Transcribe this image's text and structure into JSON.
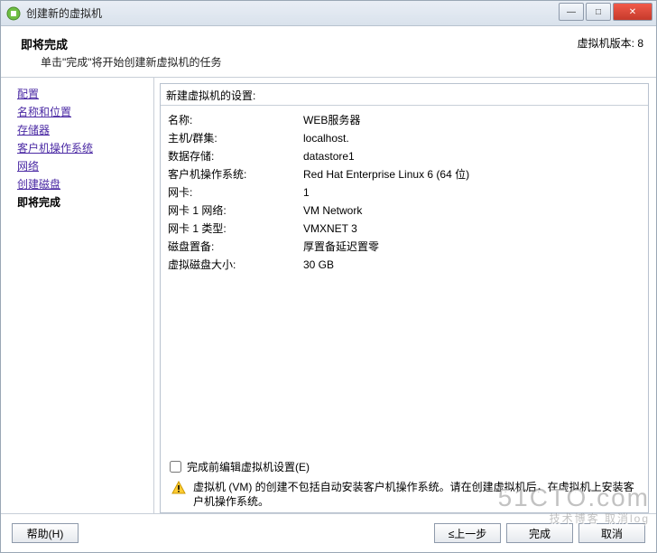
{
  "titlebar": {
    "title": "创建新的虚拟机"
  },
  "header": {
    "title": "即将完成",
    "subtitle": "单击\"完成\"将开始创建新虚拟机的任务",
    "version_label": "虚拟机版本: 8"
  },
  "nav": {
    "items": [
      "配置",
      "名称和位置",
      "存储器",
      "客户机操作系统",
      "网络",
      "创建磁盘"
    ],
    "current": "即将完成"
  },
  "settings_heading": "新建虚拟机的设置:",
  "settings": [
    {
      "k": "名称:",
      "v": "WEB服务器"
    },
    {
      "k": "主机/群集:",
      "v": "localhost."
    },
    {
      "k": "数据存储:",
      "v": "datastore1"
    },
    {
      "k": "客户机操作系统:",
      "v": "Red Hat Enterprise Linux 6 (64 位)"
    },
    {
      "k": "网卡:",
      "v": "1"
    },
    {
      "k": "网卡 1 网络:",
      "v": "VM Network"
    },
    {
      "k": "网卡 1 类型:",
      "v": "VMXNET 3"
    },
    {
      "k": "磁盘置备:",
      "v": "厚置备延迟置零"
    },
    {
      "k": "虚拟磁盘大小:",
      "v": "30 GB"
    }
  ],
  "checkbox_label": "完成前编辑虚拟机设置(E)",
  "warning_text": "虚拟机 (VM) 的创建不包括自动安装客户机操作系统。请在创建虚拟机后，在虚拟机上安装客户机操作系统。",
  "buttons": {
    "help": "帮助(H)",
    "back": "≤上一步",
    "finish": "完成",
    "cancel": "取消"
  },
  "watermark": {
    "main": "51CTO.com",
    "sub": "技术博客 取消log"
  }
}
